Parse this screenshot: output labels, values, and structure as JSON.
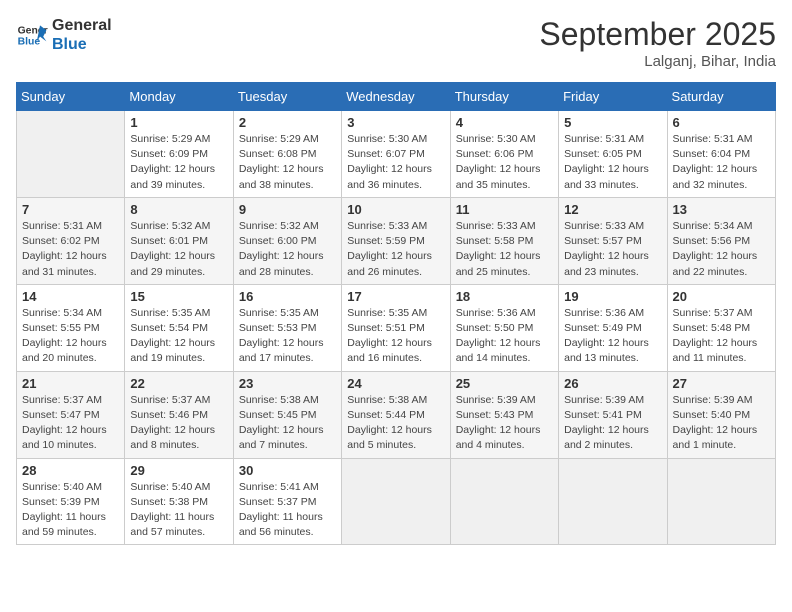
{
  "header": {
    "logo_line1": "General",
    "logo_line2": "Blue",
    "month_title": "September 2025",
    "location": "Lalganj, Bihar, India"
  },
  "weekdays": [
    "Sunday",
    "Monday",
    "Tuesday",
    "Wednesday",
    "Thursday",
    "Friday",
    "Saturday"
  ],
  "weeks": [
    [
      {
        "day": "",
        "info": ""
      },
      {
        "day": "1",
        "info": "Sunrise: 5:29 AM\nSunset: 6:09 PM\nDaylight: 12 hours\nand 39 minutes."
      },
      {
        "day": "2",
        "info": "Sunrise: 5:29 AM\nSunset: 6:08 PM\nDaylight: 12 hours\nand 38 minutes."
      },
      {
        "day": "3",
        "info": "Sunrise: 5:30 AM\nSunset: 6:07 PM\nDaylight: 12 hours\nand 36 minutes."
      },
      {
        "day": "4",
        "info": "Sunrise: 5:30 AM\nSunset: 6:06 PM\nDaylight: 12 hours\nand 35 minutes."
      },
      {
        "day": "5",
        "info": "Sunrise: 5:31 AM\nSunset: 6:05 PM\nDaylight: 12 hours\nand 33 minutes."
      },
      {
        "day": "6",
        "info": "Sunrise: 5:31 AM\nSunset: 6:04 PM\nDaylight: 12 hours\nand 32 minutes."
      }
    ],
    [
      {
        "day": "7",
        "info": "Sunrise: 5:31 AM\nSunset: 6:02 PM\nDaylight: 12 hours\nand 31 minutes."
      },
      {
        "day": "8",
        "info": "Sunrise: 5:32 AM\nSunset: 6:01 PM\nDaylight: 12 hours\nand 29 minutes."
      },
      {
        "day": "9",
        "info": "Sunrise: 5:32 AM\nSunset: 6:00 PM\nDaylight: 12 hours\nand 28 minutes."
      },
      {
        "day": "10",
        "info": "Sunrise: 5:33 AM\nSunset: 5:59 PM\nDaylight: 12 hours\nand 26 minutes."
      },
      {
        "day": "11",
        "info": "Sunrise: 5:33 AM\nSunset: 5:58 PM\nDaylight: 12 hours\nand 25 minutes."
      },
      {
        "day": "12",
        "info": "Sunrise: 5:33 AM\nSunset: 5:57 PM\nDaylight: 12 hours\nand 23 minutes."
      },
      {
        "day": "13",
        "info": "Sunrise: 5:34 AM\nSunset: 5:56 PM\nDaylight: 12 hours\nand 22 minutes."
      }
    ],
    [
      {
        "day": "14",
        "info": "Sunrise: 5:34 AM\nSunset: 5:55 PM\nDaylight: 12 hours\nand 20 minutes."
      },
      {
        "day": "15",
        "info": "Sunrise: 5:35 AM\nSunset: 5:54 PM\nDaylight: 12 hours\nand 19 minutes."
      },
      {
        "day": "16",
        "info": "Sunrise: 5:35 AM\nSunset: 5:53 PM\nDaylight: 12 hours\nand 17 minutes."
      },
      {
        "day": "17",
        "info": "Sunrise: 5:35 AM\nSunset: 5:51 PM\nDaylight: 12 hours\nand 16 minutes."
      },
      {
        "day": "18",
        "info": "Sunrise: 5:36 AM\nSunset: 5:50 PM\nDaylight: 12 hours\nand 14 minutes."
      },
      {
        "day": "19",
        "info": "Sunrise: 5:36 AM\nSunset: 5:49 PM\nDaylight: 12 hours\nand 13 minutes."
      },
      {
        "day": "20",
        "info": "Sunrise: 5:37 AM\nSunset: 5:48 PM\nDaylight: 12 hours\nand 11 minutes."
      }
    ],
    [
      {
        "day": "21",
        "info": "Sunrise: 5:37 AM\nSunset: 5:47 PM\nDaylight: 12 hours\nand 10 minutes."
      },
      {
        "day": "22",
        "info": "Sunrise: 5:37 AM\nSunset: 5:46 PM\nDaylight: 12 hours\nand 8 minutes."
      },
      {
        "day": "23",
        "info": "Sunrise: 5:38 AM\nSunset: 5:45 PM\nDaylight: 12 hours\nand 7 minutes."
      },
      {
        "day": "24",
        "info": "Sunrise: 5:38 AM\nSunset: 5:44 PM\nDaylight: 12 hours\nand 5 minutes."
      },
      {
        "day": "25",
        "info": "Sunrise: 5:39 AM\nSunset: 5:43 PM\nDaylight: 12 hours\nand 4 minutes."
      },
      {
        "day": "26",
        "info": "Sunrise: 5:39 AM\nSunset: 5:41 PM\nDaylight: 12 hours\nand 2 minutes."
      },
      {
        "day": "27",
        "info": "Sunrise: 5:39 AM\nSunset: 5:40 PM\nDaylight: 12 hours\nand 1 minute."
      }
    ],
    [
      {
        "day": "28",
        "info": "Sunrise: 5:40 AM\nSunset: 5:39 PM\nDaylight: 11 hours\nand 59 minutes."
      },
      {
        "day": "29",
        "info": "Sunrise: 5:40 AM\nSunset: 5:38 PM\nDaylight: 11 hours\nand 57 minutes."
      },
      {
        "day": "30",
        "info": "Sunrise: 5:41 AM\nSunset: 5:37 PM\nDaylight: 11 hours\nand 56 minutes."
      },
      {
        "day": "",
        "info": ""
      },
      {
        "day": "",
        "info": ""
      },
      {
        "day": "",
        "info": ""
      },
      {
        "day": "",
        "info": ""
      }
    ]
  ]
}
